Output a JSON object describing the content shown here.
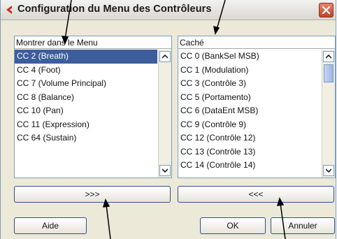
{
  "dialog": {
    "title": "Configuration du Menu des Contrôleurs"
  },
  "left_panel": {
    "header": "Montrer dans le Menu",
    "items": [
      {
        "label": "CC 2 (Breath)",
        "selected": true
      },
      {
        "label": "CC 4 (Foot)"
      },
      {
        "label": "CC 7 (Volume Principal)"
      },
      {
        "label": "CC 8 (Balance)"
      },
      {
        "label": "CC 10 (Pan)"
      },
      {
        "label": "CC 11 (Expression)"
      },
      {
        "label": "CC 64 (Sustain)"
      }
    ]
  },
  "right_panel": {
    "header": "Caché",
    "items": [
      {
        "label": "CC 0 (BankSel MSB)"
      },
      {
        "label": "CC 1 (Modulation)"
      },
      {
        "label": "CC 3 (Contrôle 3)"
      },
      {
        "label": "CC 5 (Portamento)"
      },
      {
        "label": "CC 6 (DataEnt MSB)"
      },
      {
        "label": "CC 9 (Contrôle 9)"
      },
      {
        "label": "CC 12 (Contrôle 12)"
      },
      {
        "label": "CC 13 (Contrôle 13)"
      },
      {
        "label": "CC 14 (Contrôle 14)"
      }
    ]
  },
  "buttons": {
    "move_right": ">>>",
    "move_left": "<<<",
    "help": "Aide",
    "ok": "OK",
    "cancel": "Annuler"
  }
}
